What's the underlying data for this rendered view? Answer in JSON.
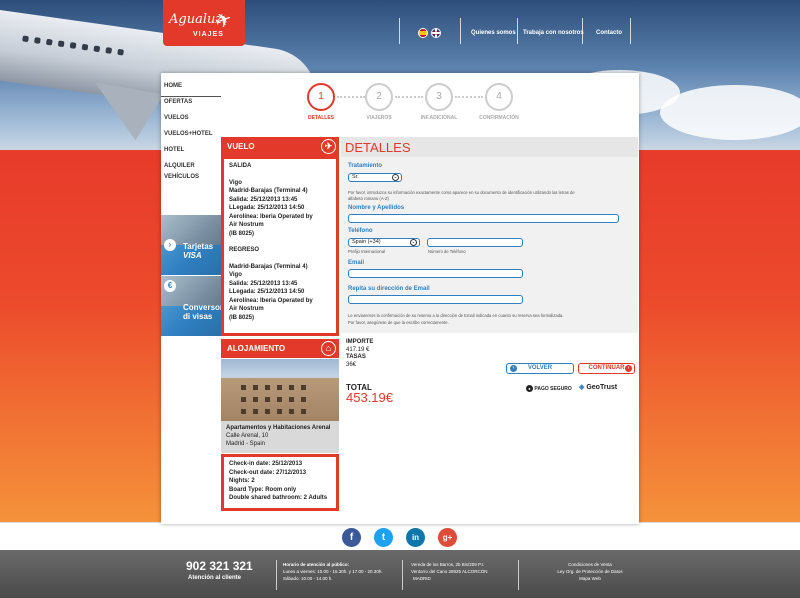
{
  "brand": {
    "name": "Agualuz",
    "sub": "VIAJES"
  },
  "topnav": [
    "Quienes somos",
    "Trabaja con nosotros",
    "Contacto"
  ],
  "sidenav": [
    "HOME",
    "OFERTAS",
    "VUELOS",
    "VUELOS+HOTEL",
    "HOTEL",
    "ALQUILER VEHÍCULOS"
  ],
  "promos": [
    {
      "title": "Tarjetas",
      "sub": "VISA"
    },
    {
      "title": "Conversor",
      "sub": "di visas"
    }
  ],
  "steps": [
    {
      "num": "1",
      "label": "DETALLES"
    },
    {
      "num": "2",
      "label": "VIAJEROS"
    },
    {
      "num": "3",
      "label": "INF.ADICIONAL"
    },
    {
      "num": "4",
      "label": "CONFIRMACIÓN"
    }
  ],
  "flight": {
    "heading": "VUELO",
    "outbound_title": "SALIDA",
    "outbound": [
      "Vigo",
      "Madrid-Barajas (Terminal 4)",
      "Salida: 25/12/2013 13:45",
      "LLegada: 25/12/2013 14:50",
      "Aerolínea: Iberia Operated by",
      "Air Nostrum",
      "(IB 8025)"
    ],
    "return_title": "REGRESO",
    "return": [
      "Madrid-Barajas (Terminal 4)",
      "Vigo",
      "Salida: 25/12/2013 13:45",
      "LLegada: 25/12/2013 14:50",
      "Aerolínea: Iberia Operated by",
      "Air Nostrum",
      "(IB 8025)"
    ]
  },
  "hotel": {
    "heading": "ALOJAMIENTO",
    "name": "Apartamentos y Habitaciones Arenal",
    "address": [
      "Calle Arenal, 10",
      "Madrid - Spain"
    ],
    "stay": [
      "Check-in date: 25/12/2013",
      "Check-out date: 27/12/2013",
      "Nights: 2",
      "Board Type: Room only",
      "Double shared bathroom: 2 Adults"
    ]
  },
  "details": {
    "title": "DETALLES",
    "treatment_label": "Tratamiento",
    "treatment_value": "Sr.",
    "name_hint": "Por favor, introduzca su información exactamente como aparece en su documento de identificación utilizando las letras de alfabeto romano (A-Z)",
    "name_label": "Nombre y Apellidos",
    "phone_label": "Teléfono",
    "phone_prefix_value": "Spain (+34)",
    "prefix_caption": "Prefijo Internacional",
    "number_caption": "Número de Teléfono",
    "email_label": "Email",
    "email_repeat_label": "Repita su dirección de Email",
    "email_hint_1": "Le enviaremos la confirmación de su reserva a la dirección de Email indicada en cuanto su reserva sea formalizada.",
    "email_hint_2": "Por favor, asegúrese de que la escribe correctamente."
  },
  "price": {
    "importe_label": "IMPORTE",
    "importe_value": "417.19 €",
    "tasas_label": "TASAS",
    "tasas_value": "36€",
    "total_label": "TOTAL",
    "total_value": "453.19€"
  },
  "buttons": {
    "back": "VOLVER",
    "next": "CONTINUAR"
  },
  "badges": {
    "secure": "PAGO SEGURO",
    "geotrust": "GeoTrust"
  },
  "social": [
    "f",
    "t",
    "in",
    "g+"
  ],
  "footer": {
    "phone": "902 321 321",
    "phone_sub": "Atención al cliente",
    "hours": [
      "Horario de atención al público:",
      "Lunes a viernes: 10.00 - 15.30h. y 17.00 - 20.30h.",
      "Sábado: 10.00 - 14.00 h."
    ],
    "address": [
      "Vereda de los Barros, 2b Bis/209 P.I.",
      "Ventorro del Cano 28925 ALCORCÓN",
      "MADRID"
    ],
    "links": [
      "Condiciones de Venta",
      "Ley Org. de Protección de Datos",
      "Mapa Web"
    ]
  },
  "colors": {
    "accent": "#e2392b",
    "blue": "#2f7fc1",
    "facebook": "#3b5998",
    "twitter": "#1da1f2",
    "linkedin": "#0e76a8",
    "google": "#dd4b39"
  }
}
